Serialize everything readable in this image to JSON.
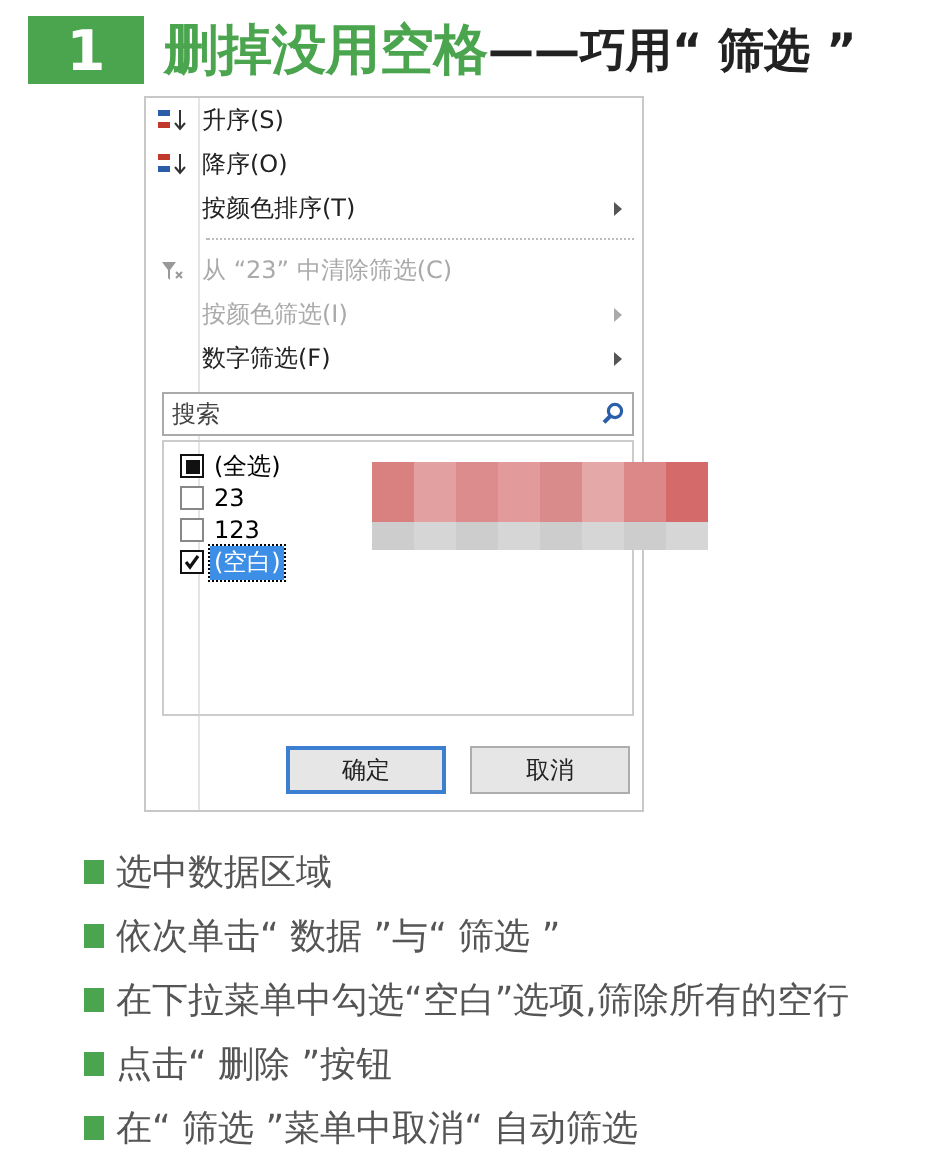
{
  "heading": {
    "number": "1",
    "title": "删掉没用空格",
    "subtitle": "——巧用“ 筛选 ”"
  },
  "menu": {
    "items": [
      {
        "kind": "sort-asc",
        "label": "升序(S)",
        "disabled": false,
        "submenu": false
      },
      {
        "kind": "sort-desc",
        "label": "降序(O)",
        "disabled": false,
        "submenu": false
      },
      {
        "kind": "plain",
        "label": "按颜色排序(T)",
        "disabled": false,
        "submenu": true
      },
      {
        "kind": "separator"
      },
      {
        "kind": "clear-filter",
        "label": "从 “23” 中清除筛选(C)",
        "disabled": true,
        "submenu": false
      },
      {
        "kind": "plain",
        "label": "按颜色筛选(I)",
        "disabled": true,
        "submenu": true
      },
      {
        "kind": "plain",
        "label": "数字筛选(F)",
        "disabled": false,
        "submenu": true
      }
    ],
    "search": {
      "placeholder": "搜索"
    },
    "values": [
      {
        "label": "(全选)",
        "checked": true,
        "mixed": true,
        "selected": false
      },
      {
        "label": "23",
        "checked": false,
        "mixed": false,
        "selected": false
      },
      {
        "label": "123",
        "checked": false,
        "mixed": false,
        "selected": false
      },
      {
        "label": "(空白)",
        "checked": true,
        "mixed": false,
        "selected": true
      }
    ],
    "buttons": [
      "确定",
      "取消"
    ]
  },
  "steps": [
    "选中数据区域",
    "依次单击“ 数据 ”与“ 筛选 ”",
    "在下拉菜单中勾选“空白”选项,筛除所有的空行",
    "点击“ 删除 ”按钮",
    "在“ 筛选 ”菜单中取消“ 自动筛选"
  ]
}
